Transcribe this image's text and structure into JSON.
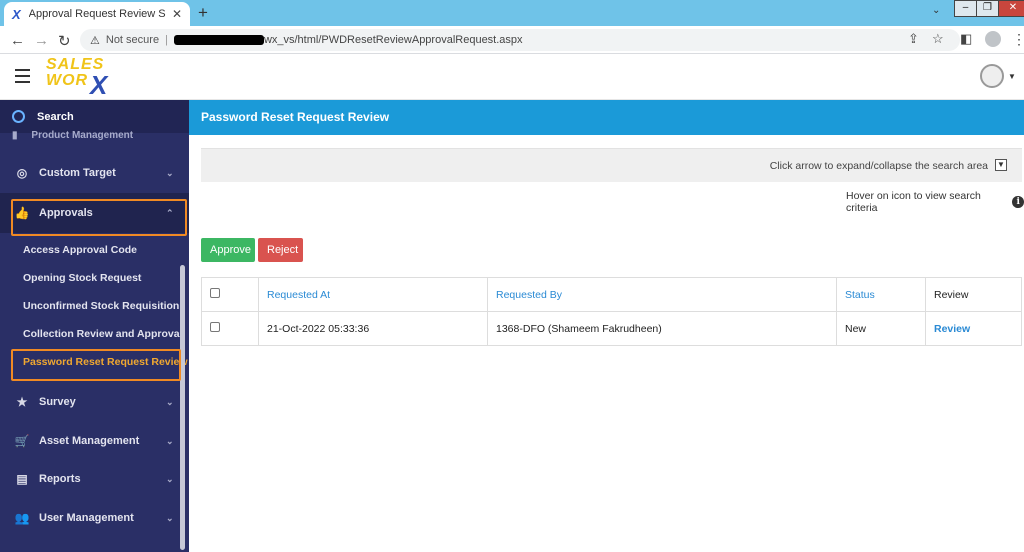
{
  "browser": {
    "tab_title": "Approval Request Review SalesW",
    "new_tab": "+",
    "not_secure": "Not secure",
    "url_path": "wx_vs/html/PWDResetReviewApprovalRequest.aspx"
  },
  "sidebar": {
    "search_label": "Search",
    "cut_item": "Product Management",
    "items": [
      {
        "label": "Custom Target"
      },
      {
        "label": "Approvals"
      },
      {
        "label": "Survey"
      },
      {
        "label": "Asset Management"
      },
      {
        "label": "Reports"
      },
      {
        "label": "User Management"
      }
    ],
    "approvals_sub": [
      {
        "label": "Access Approval Code"
      },
      {
        "label": "Opening Stock Request"
      },
      {
        "label": "Unconfirmed Stock Requisition"
      },
      {
        "label": "Collection Review and Approval"
      },
      {
        "label": "Password Reset Request Review"
      }
    ]
  },
  "main": {
    "page_title": "Password Reset Request Review",
    "search_toggle_text": "Click arrow to expand/collapse the search area",
    "hover_hint": "Hover on icon to view search criteria",
    "approve_label": "Approve",
    "reject_label": "Reject",
    "table": {
      "headers": [
        "Requested At",
        "Requested By",
        "Status",
        "Review"
      ],
      "rows": [
        {
          "requested_at": "21-Oct-2022 05:33:36",
          "requested_by": "1368-DFO (Shameem Fakrudheen)",
          "status": "New",
          "review": "Review"
        }
      ]
    }
  },
  "colors": {
    "sidebar_bg": "#2a2f66",
    "header_blue": "#1b9ad8",
    "highlight_orange": "#f08a24",
    "approve_green": "#3cb763",
    "reject_red": "#d9534f"
  }
}
